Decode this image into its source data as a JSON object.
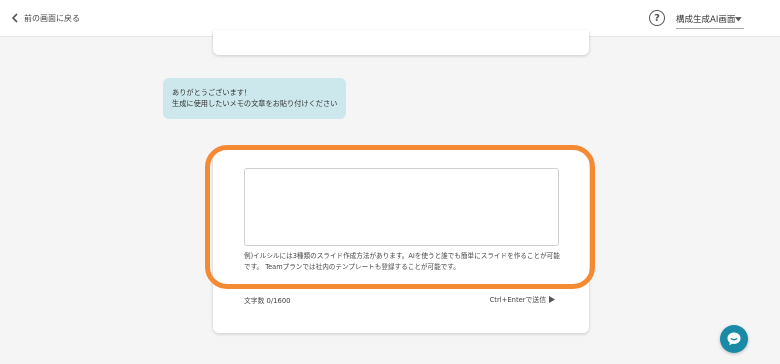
{
  "header": {
    "back_label": "前の画面に戻る",
    "help_glyph": "?",
    "mode_label": "構成生成AI画面"
  },
  "bubble": {
    "line1": "ありがとうございます！",
    "line2": "生成に使用したいメモの文章をお貼り付けください"
  },
  "input": {
    "value": "",
    "example": "例)イルシルには3種類のスライド作成方法があります。AIを使うと誰でも簡単にスライドを作ることが可能です。 Teamプランでは社内のテンプレートも登録することが可能です。",
    "char_count": "文字数 0/1600",
    "send_label": "Ctrl+Enterで送信"
  },
  "colors": {
    "highlight": "#f58a34",
    "bubble_bg": "#cce8ec",
    "fab": "#1a8aa6"
  },
  "icons": {
    "back": "chevron-left-icon",
    "help": "question-circle-icon",
    "dropdown": "caret-down-icon",
    "send": "play-triangle-icon",
    "chat": "chat-bubble-icon"
  }
}
